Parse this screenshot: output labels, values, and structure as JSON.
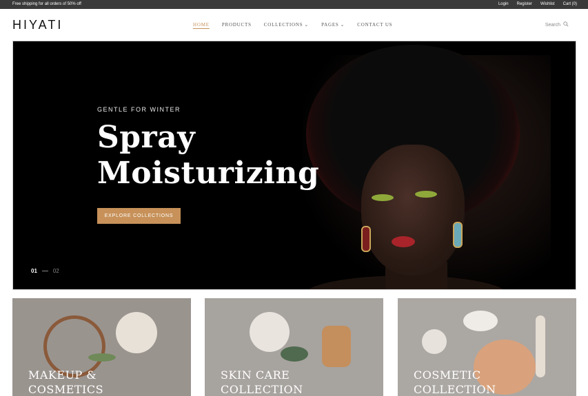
{
  "topbar": {
    "promo": "Free shipping for all orders of 50% off",
    "links": [
      "Login",
      "Register",
      "Wishlist",
      "Cart (0)"
    ]
  },
  "header": {
    "logo": "HIYATI",
    "nav": [
      {
        "label": "HOME",
        "active": true,
        "dropdown": false
      },
      {
        "label": "PRODUCTS",
        "active": false,
        "dropdown": false
      },
      {
        "label": "COLLECTIONS",
        "active": false,
        "dropdown": true
      },
      {
        "label": "PAGES",
        "active": false,
        "dropdown": true
      },
      {
        "label": "CONTACT US",
        "active": false,
        "dropdown": false
      }
    ],
    "search_label": "Search",
    "search_icon": "search-icon"
  },
  "hero": {
    "eyebrow": "GENTLE FOR WINTER",
    "title_line1": "Spray",
    "title_line2": "Moisturizing",
    "cta": "EXPLORE COLLECTIONS",
    "pager_current": "01",
    "pager_next": "02"
  },
  "cards": [
    {
      "line1": "MAKEUP &",
      "line2": "COSMETICS"
    },
    {
      "line1": "SKIN CARE",
      "line2": "COLLECTION"
    },
    {
      "line1": "COSMETIC",
      "line2": "COLLECTION"
    }
  ],
  "colors": {
    "accent": "#c79159",
    "topbar": "#3a3a3a",
    "hero_bg": "#000000"
  }
}
